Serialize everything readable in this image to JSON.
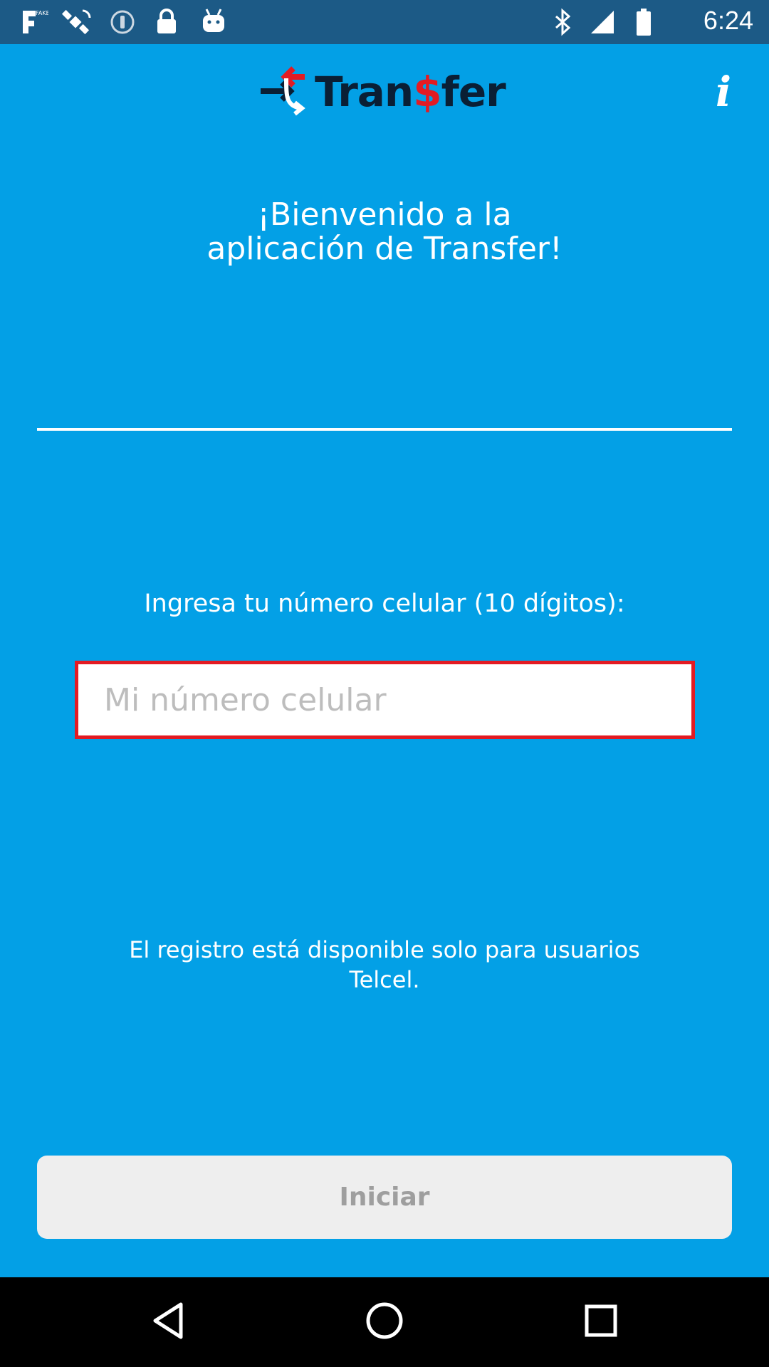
{
  "status_bar": {
    "time": "6:24",
    "left_icons": [
      "fake-gps-icon",
      "satellite-icon",
      "sync-icon",
      "lock-icon",
      "android-icon"
    ],
    "right_icons": [
      "bluetooth-icon",
      "signal-icon",
      "battery-icon"
    ]
  },
  "header": {
    "logo_text_before": "Tran",
    "logo_text_dollar": "$",
    "logo_text_after": "fer",
    "info_label": "i"
  },
  "main": {
    "welcome_line1": "¡Bienvenido a la",
    "welcome_line2": "aplicación de Transfer!",
    "prompt": "Ingresa tu número celular (10 dígitos):",
    "phone_placeholder": "Mi número celular",
    "phone_value": "",
    "notice_line1": "El registro está disponible solo para usuarios",
    "notice_line2": "Telcel.",
    "start_label": "Iniciar"
  },
  "colors": {
    "background": "#03a0e6",
    "status_bar": "#1c5a86",
    "accent_red": "#e31b23",
    "logo_dark": "#0a1f35",
    "button_bg": "#eeeeee",
    "button_text": "#9e9e9e"
  },
  "nav_bar": {
    "buttons": [
      "back-icon",
      "home-icon",
      "recents-icon"
    ]
  }
}
